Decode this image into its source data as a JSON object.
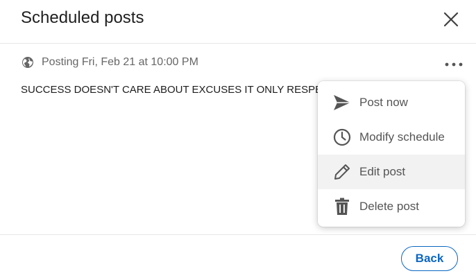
{
  "dialog": {
    "title": "Scheduled posts",
    "close_icon": "close-icon"
  },
  "post": {
    "visibility_icon": "globe-icon",
    "posting_text": "Posting Fri, Feb 21 at 10:00 PM",
    "more_icon": "more-options-icon",
    "content": "SUCCESS DOESN'T CARE ABOUT EXCUSES IT ONLY RESPECTS ACTION"
  },
  "menu": {
    "items": [
      {
        "label": "Post now",
        "icon": "send-icon"
      },
      {
        "label": "Modify schedule",
        "icon": "clock-icon"
      },
      {
        "label": "Edit post",
        "icon": "pencil-icon"
      },
      {
        "label": "Delete post",
        "icon": "trash-icon"
      }
    ],
    "highlighted_item": "Edit post"
  },
  "footer": {
    "back_label": "Back"
  },
  "colors": {
    "accent": "#0a66c2",
    "text_primary": "#1d1d1d",
    "text_secondary": "#666666",
    "icon": "#555555",
    "hover_bg": "#f3f2f2"
  }
}
